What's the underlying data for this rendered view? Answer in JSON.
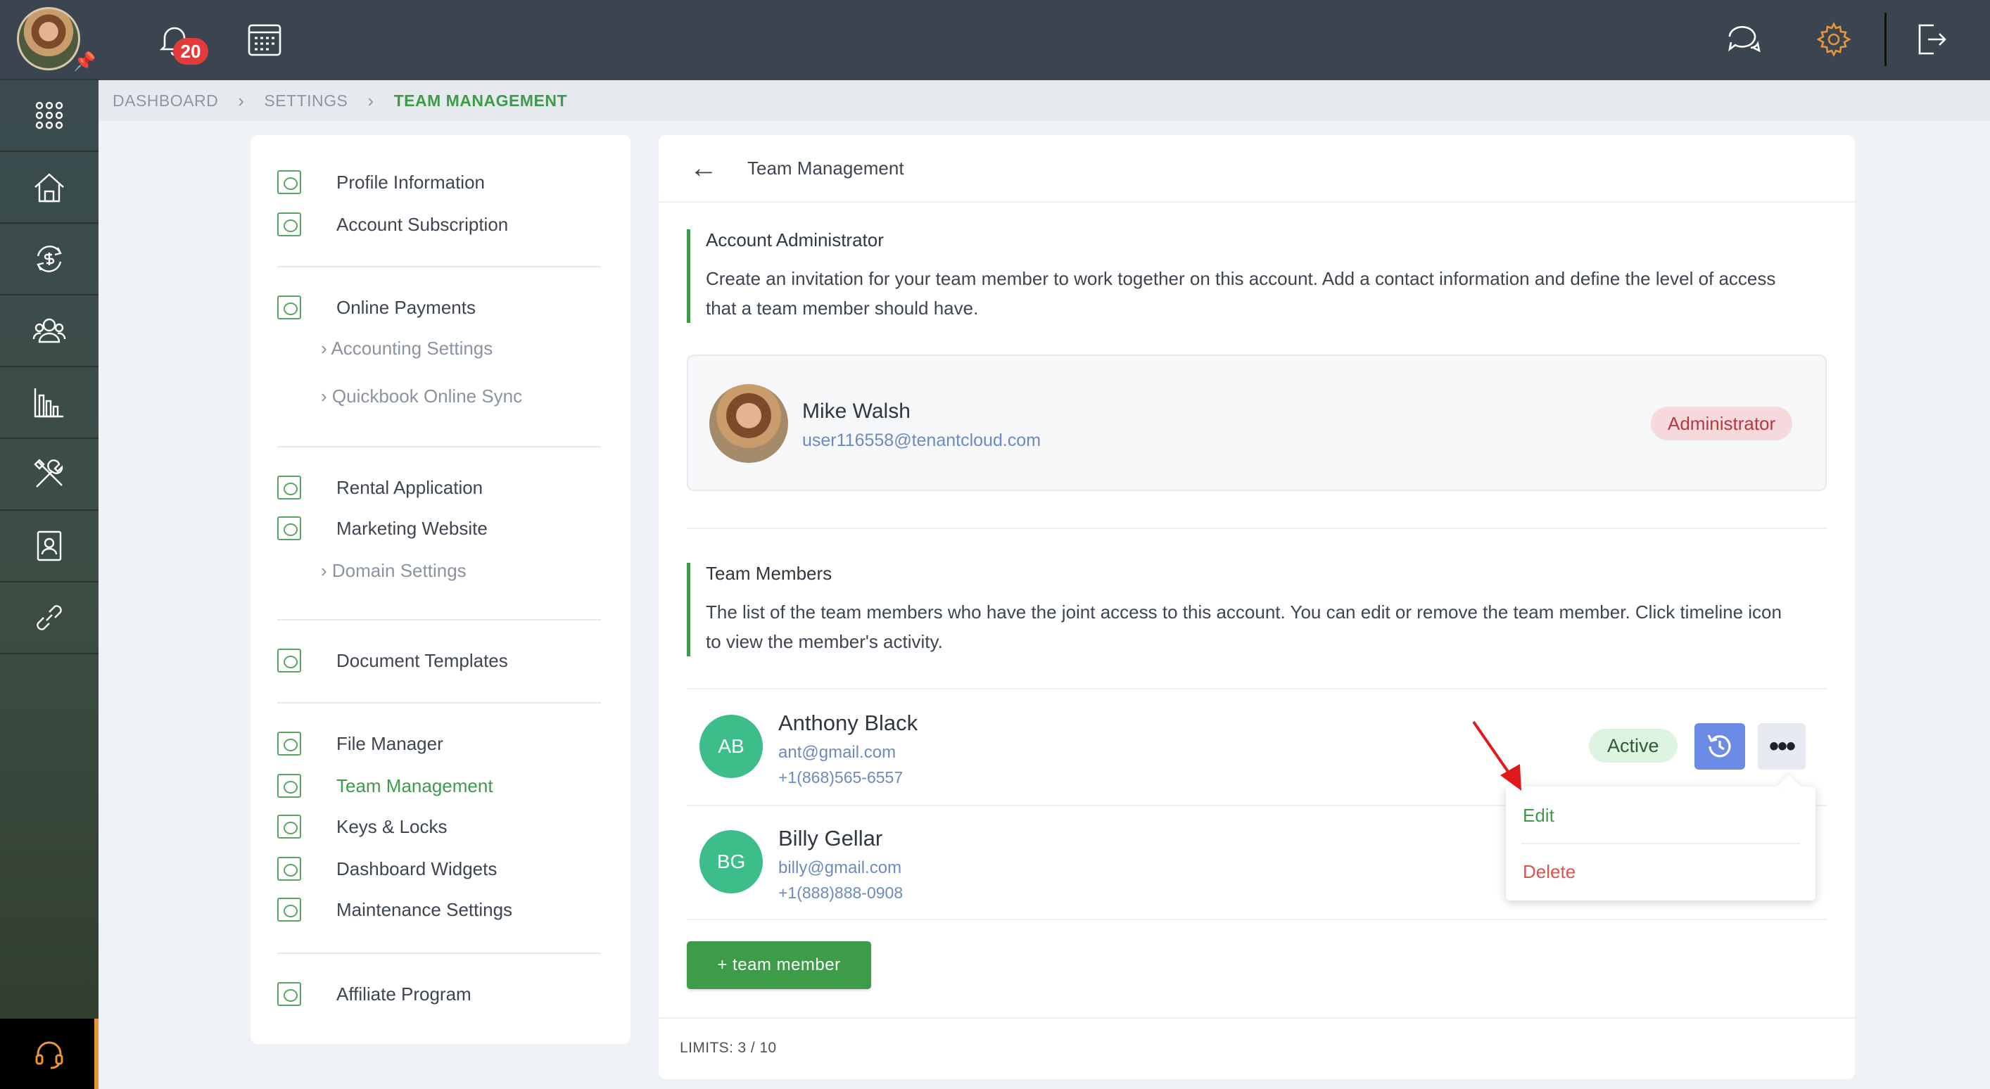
{
  "topbar": {
    "notifications_count": "20"
  },
  "breadcrumb": {
    "items": [
      "DASHBOARD",
      "SETTINGS",
      "TEAM MANAGEMENT"
    ]
  },
  "menu": {
    "profile_information": "Profile Information",
    "account_subscription": "Account Subscription",
    "online_payments": "Online Payments",
    "accounting_settings": "Accounting Settings",
    "quickbook_online_sync": "Quickbook Online Sync",
    "rental_application": "Rental Application",
    "marketing_website": "Marketing Website",
    "domain_settings": "Domain Settings",
    "document_templates": "Document Templates",
    "file_manager": "File Manager",
    "team_management": "Team Management",
    "keys_locks": "Keys & Locks",
    "dashboard_widgets": "Dashboard Widgets",
    "maintenance_settings": "Maintenance Settings",
    "affiliate_program": "Affiliate Program"
  },
  "main": {
    "title": "Team Management",
    "admin_section": {
      "heading": "Account Administrator",
      "description": "Create an invitation for your team member to work together on this account. Add a contact information and define the level of access that a team member should have."
    },
    "admin": {
      "name": "Mike Walsh",
      "email": "user116558@tenantcloud.com",
      "role": "Administrator"
    },
    "members_section": {
      "heading": "Team Members",
      "description": "The list of the team members who have the joint access to this account. You can edit or remove the team member. Click timeline icon to view the member's activity."
    },
    "members": [
      {
        "initials": "AB",
        "name": "Anthony Black",
        "email": "ant@gmail.com",
        "phone": "+1(868)565-6557",
        "status": "Active"
      },
      {
        "initials": "BG",
        "name": "Billy Gellar",
        "email": "billy@gmail.com",
        "phone": "+1(888)888-0908"
      }
    ],
    "dropdown": {
      "edit": "Edit",
      "delete": "Delete"
    },
    "add_button": "+ team member",
    "limits": "LIMITS: 3 / 10"
  },
  "colors": {
    "accent_green": "#3f9a4c",
    "sidebar_dark": "#3a454f",
    "delete_red": "#d9534f",
    "timeline_blue": "#6b8be6"
  }
}
